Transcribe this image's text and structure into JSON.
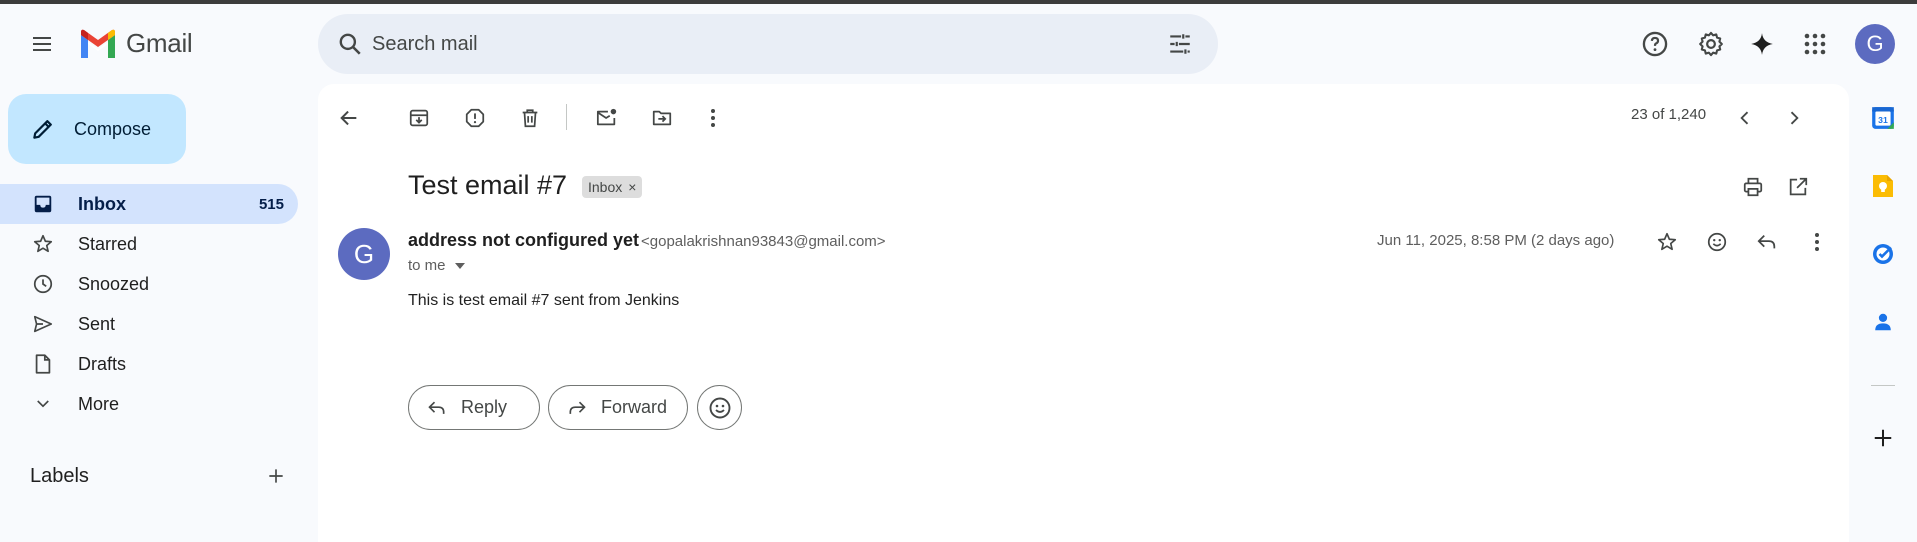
{
  "app": {
    "name": "Gmail"
  },
  "search": {
    "placeholder": "Search mail"
  },
  "sidebar": {
    "compose_label": "Compose",
    "items": [
      {
        "label": "Inbox",
        "count": "515"
      },
      {
        "label": "Starred",
        "count": ""
      },
      {
        "label": "Snoozed",
        "count": ""
      },
      {
        "label": "Sent",
        "count": ""
      },
      {
        "label": "Drafts",
        "count": ""
      },
      {
        "label": "More",
        "count": ""
      }
    ],
    "labels_heading": "Labels"
  },
  "toolbar": {
    "pager": "23 of 1,240"
  },
  "email": {
    "subject": "Test email #7",
    "label_chip": "Inbox",
    "sender_name": "address not configured yet",
    "sender_email": "<gopalakrishnan93843@gmail.com>",
    "recipient": "to me",
    "date": "Jun 11, 2025, 8:58 PM (2 days ago)",
    "body": "This is test email #7 sent from Jenkins",
    "avatar_letter": "G"
  },
  "actions": {
    "reply_label": "Reply",
    "forward_label": "Forward"
  },
  "account": {
    "avatar_letter": "G"
  },
  "colors": {
    "compose_bg": "#c2e7ff",
    "inbox_active_bg": "#d3e3fd",
    "avatar_bg": "#5c6bc0",
    "search_bg": "#e9eef6"
  }
}
